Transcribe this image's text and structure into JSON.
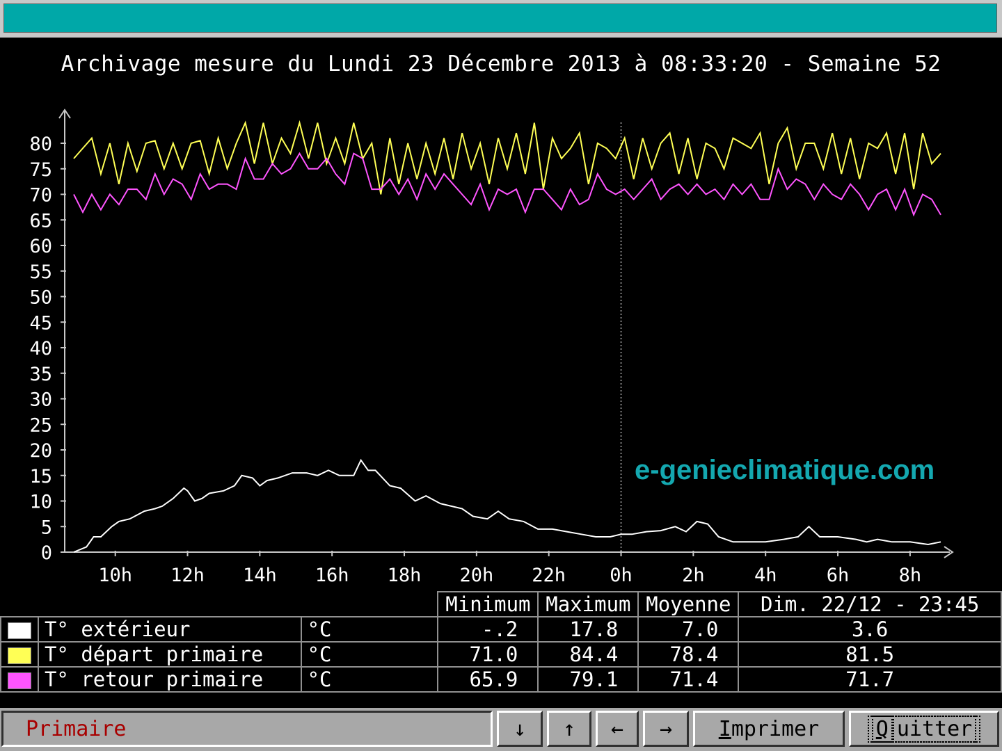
{
  "title": "Archivage mesure du Lundi 23 Décembre 2013 à 08:33:20 - Semaine 52",
  "watermark": "e-genieclimatique.com",
  "colors": {
    "exterieur": "#ffffff",
    "depart": "#ffff55",
    "retour": "#ff55ff",
    "accent": "#00a8a8"
  },
  "chart_data": {
    "type": "line",
    "title": "",
    "xlabel": "",
    "ylabel": "",
    "ylim": [
      0,
      85
    ],
    "yticks": [
      0,
      5,
      10,
      15,
      20,
      25,
      30,
      35,
      40,
      45,
      50,
      55,
      60,
      65,
      70,
      75,
      80
    ],
    "x_tick_labels": [
      {
        "x": 10,
        "label": "10h"
      },
      {
        "x": 12,
        "label": "12h"
      },
      {
        "x": 14,
        "label": "14h"
      },
      {
        "x": 16,
        "label": "16h"
      },
      {
        "x": 18,
        "label": "18h"
      },
      {
        "x": 20,
        "label": "20h"
      },
      {
        "x": 22,
        "label": "22h"
      },
      {
        "x": 24,
        "label": "0h"
      },
      {
        "x": 26,
        "label": "2h"
      },
      {
        "x": 28,
        "label": "4h"
      },
      {
        "x": 30,
        "label": "6h"
      },
      {
        "x": 32,
        "label": "8h"
      }
    ],
    "xlim": [
      8.6,
      32.85
    ],
    "marker_x": 24,
    "series": [
      {
        "name": "T° départ primaire",
        "color": "#ffff55",
        "points": [
          [
            8.85,
            77
          ],
          [
            9.35,
            81
          ],
          [
            9.6,
            74
          ],
          [
            9.85,
            80
          ],
          [
            10.1,
            72
          ],
          [
            10.35,
            80
          ],
          [
            10.6,
            74.5
          ],
          [
            10.85,
            80
          ],
          [
            11.1,
            80.5
          ],
          [
            11.35,
            75
          ],
          [
            11.6,
            80
          ],
          [
            11.85,
            75
          ],
          [
            12.1,
            80
          ],
          [
            12.35,
            80.5
          ],
          [
            12.6,
            74
          ],
          [
            12.85,
            81
          ],
          [
            13.1,
            75
          ],
          [
            13.35,
            80
          ],
          [
            13.6,
            84
          ],
          [
            13.85,
            76
          ],
          [
            14.1,
            84
          ],
          [
            14.35,
            76
          ],
          [
            14.6,
            81
          ],
          [
            14.85,
            78
          ],
          [
            15.1,
            84
          ],
          [
            15.35,
            77
          ],
          [
            15.6,
            84
          ],
          [
            15.85,
            76
          ],
          [
            16.1,
            81
          ],
          [
            16.35,
            76
          ],
          [
            16.6,
            84
          ],
          [
            16.85,
            77
          ],
          [
            17.1,
            80
          ],
          [
            17.35,
            70
          ],
          [
            17.6,
            81
          ],
          [
            17.85,
            72
          ],
          [
            18.1,
            80
          ],
          [
            18.35,
            73
          ],
          [
            18.6,
            80
          ],
          [
            18.85,
            74
          ],
          [
            19.1,
            81
          ],
          [
            19.35,
            73
          ],
          [
            19.6,
            82
          ],
          [
            19.85,
            75
          ],
          [
            20.1,
            80
          ],
          [
            20.35,
            72
          ],
          [
            20.6,
            81
          ],
          [
            20.85,
            75
          ],
          [
            21.1,
            82
          ],
          [
            21.35,
            74
          ],
          [
            21.6,
            84
          ],
          [
            21.85,
            71
          ],
          [
            22.1,
            81
          ],
          [
            22.35,
            77
          ],
          [
            22.6,
            79
          ],
          [
            22.85,
            82
          ],
          [
            23.1,
            72
          ],
          [
            23.35,
            80
          ],
          [
            23.6,
            79
          ],
          [
            23.85,
            77
          ],
          [
            24.1,
            81
          ],
          [
            24.35,
            73
          ],
          [
            24.6,
            81
          ],
          [
            24.85,
            75
          ],
          [
            25.1,
            80
          ],
          [
            25.35,
            82
          ],
          [
            25.6,
            74
          ],
          [
            25.85,
            81
          ],
          [
            26.1,
            73
          ],
          [
            26.35,
            80
          ],
          [
            26.6,
            79
          ],
          [
            26.85,
            75
          ],
          [
            27.1,
            81
          ],
          [
            27.35,
            80
          ],
          [
            27.6,
            79
          ],
          [
            27.85,
            82
          ],
          [
            28.1,
            72
          ],
          [
            28.35,
            80
          ],
          [
            28.6,
            83
          ],
          [
            28.85,
            75
          ],
          [
            29.1,
            80
          ],
          [
            29.35,
            80
          ],
          [
            29.6,
            75
          ],
          [
            29.85,
            82
          ],
          [
            30.1,
            74
          ],
          [
            30.35,
            81
          ],
          [
            30.6,
            73
          ],
          [
            30.85,
            80
          ],
          [
            31.1,
            79
          ],
          [
            31.35,
            82
          ],
          [
            31.6,
            74
          ],
          [
            31.85,
            82
          ],
          [
            32.1,
            71
          ],
          [
            32.35,
            82
          ],
          [
            32.6,
            76
          ],
          [
            32.85,
            78
          ]
        ]
      },
      {
        "name": "T° retour primaire",
        "color": "#ff55ff",
        "points": [
          [
            8.85,
            70
          ],
          [
            9.1,
            66.5
          ],
          [
            9.35,
            70
          ],
          [
            9.6,
            67
          ],
          [
            9.85,
            70
          ],
          [
            10.1,
            68
          ],
          [
            10.35,
            71
          ],
          [
            10.6,
            71
          ],
          [
            10.85,
            69
          ],
          [
            11.1,
            74
          ],
          [
            11.35,
            70
          ],
          [
            11.6,
            73
          ],
          [
            11.85,
            72
          ],
          [
            12.1,
            69
          ],
          [
            12.35,
            74
          ],
          [
            12.6,
            71
          ],
          [
            12.85,
            72
          ],
          [
            13.1,
            72
          ],
          [
            13.35,
            71
          ],
          [
            13.6,
            77
          ],
          [
            13.85,
            73
          ],
          [
            14.1,
            73
          ],
          [
            14.35,
            76
          ],
          [
            14.6,
            74
          ],
          [
            14.85,
            75
          ],
          [
            15.1,
            78
          ],
          [
            15.35,
            75
          ],
          [
            15.6,
            75
          ],
          [
            15.85,
            77
          ],
          [
            16.1,
            74
          ],
          [
            16.35,
            72
          ],
          [
            16.6,
            78
          ],
          [
            16.85,
            77
          ],
          [
            17.1,
            71
          ],
          [
            17.35,
            71
          ],
          [
            17.6,
            73
          ],
          [
            17.85,
            70
          ],
          [
            18.1,
            73
          ],
          [
            18.35,
            69
          ],
          [
            18.6,
            74
          ],
          [
            18.85,
            71
          ],
          [
            19.1,
            74
          ],
          [
            19.35,
            72
          ],
          [
            19.6,
            70
          ],
          [
            19.85,
            68
          ],
          [
            20.1,
            72
          ],
          [
            20.35,
            67
          ],
          [
            20.6,
            71
          ],
          [
            20.85,
            70
          ],
          [
            21.1,
            71
          ],
          [
            21.35,
            66.5
          ],
          [
            21.6,
            71
          ],
          [
            21.85,
            71
          ],
          [
            22.1,
            69
          ],
          [
            22.35,
            67
          ],
          [
            22.6,
            71
          ],
          [
            22.85,
            68
          ],
          [
            23.1,
            69
          ],
          [
            23.35,
            74
          ],
          [
            23.6,
            71
          ],
          [
            23.85,
            70
          ],
          [
            24.1,
            71
          ],
          [
            24.35,
            69
          ],
          [
            24.6,
            71
          ],
          [
            24.85,
            73
          ],
          [
            25.1,
            69
          ],
          [
            25.35,
            71
          ],
          [
            25.6,
            72
          ],
          [
            25.85,
            70
          ],
          [
            26.1,
            72
          ],
          [
            26.35,
            70
          ],
          [
            26.6,
            71
          ],
          [
            26.85,
            69
          ],
          [
            27.1,
            72
          ],
          [
            27.35,
            70
          ],
          [
            27.6,
            72
          ],
          [
            27.85,
            69
          ],
          [
            28.1,
            69
          ],
          [
            28.35,
            75
          ],
          [
            28.6,
            71
          ],
          [
            28.85,
            73
          ],
          [
            29.1,
            72
          ],
          [
            29.35,
            69
          ],
          [
            29.6,
            72
          ],
          [
            29.85,
            70
          ],
          [
            30.1,
            69
          ],
          [
            30.35,
            72
          ],
          [
            30.6,
            70
          ],
          [
            30.85,
            67
          ],
          [
            31.1,
            70
          ],
          [
            31.35,
            71
          ],
          [
            31.6,
            67
          ],
          [
            31.85,
            71
          ],
          [
            32.1,
            66
          ],
          [
            32.35,
            70
          ],
          [
            32.6,
            69
          ],
          [
            32.85,
            66
          ]
        ]
      },
      {
        "name": "T° extérieur",
        "color": "#ffffff",
        "points": [
          [
            8.85,
            0
          ],
          [
            9.2,
            1
          ],
          [
            9.4,
            3
          ],
          [
            9.6,
            3
          ],
          [
            9.9,
            5
          ],
          [
            10.1,
            6
          ],
          [
            10.4,
            6.5
          ],
          [
            10.8,
            8
          ],
          [
            11.1,
            8.5
          ],
          [
            11.3,
            9
          ],
          [
            11.6,
            10.5
          ],
          [
            11.9,
            12.5
          ],
          [
            12,
            12
          ],
          [
            12.2,
            10
          ],
          [
            12.4,
            10.5
          ],
          [
            12.6,
            11.5
          ],
          [
            13,
            12
          ],
          [
            13.3,
            13
          ],
          [
            13.5,
            15
          ],
          [
            13.8,
            14.5
          ],
          [
            14,
            13
          ],
          [
            14.2,
            14
          ],
          [
            14.5,
            14.5
          ],
          [
            14.9,
            15.5
          ],
          [
            15.3,
            15.5
          ],
          [
            15.6,
            15
          ],
          [
            15.9,
            16
          ],
          [
            16.2,
            15
          ],
          [
            16.6,
            15
          ],
          [
            16.8,
            18
          ],
          [
            17,
            16
          ],
          [
            17.2,
            16
          ],
          [
            17.6,
            13
          ],
          [
            17.9,
            12.5
          ],
          [
            18.3,
            10
          ],
          [
            18.6,
            11
          ],
          [
            19,
            9.5
          ],
          [
            19.3,
            9
          ],
          [
            19.6,
            8.5
          ],
          [
            19.9,
            7
          ],
          [
            20.3,
            6.5
          ],
          [
            20.6,
            8
          ],
          [
            20.9,
            6.5
          ],
          [
            21.3,
            6
          ],
          [
            21.7,
            4.5
          ],
          [
            22.1,
            4.5
          ],
          [
            22.5,
            4
          ],
          [
            22.9,
            3.5
          ],
          [
            23.3,
            3
          ],
          [
            23.7,
            3
          ],
          [
            24,
            3.5
          ],
          [
            24.3,
            3.5
          ],
          [
            24.7,
            4
          ],
          [
            25.1,
            4.2
          ],
          [
            25.5,
            5
          ],
          [
            25.8,
            4
          ],
          [
            26.1,
            6
          ],
          [
            26.4,
            5.5
          ],
          [
            26.7,
            3
          ],
          [
            27.1,
            2
          ],
          [
            27.6,
            2
          ],
          [
            28,
            2
          ],
          [
            28.5,
            2.5
          ],
          [
            28.9,
            3
          ],
          [
            29.2,
            5
          ],
          [
            29.5,
            3
          ],
          [
            30,
            3
          ],
          [
            30.5,
            2.5
          ],
          [
            30.8,
            2
          ],
          [
            31.1,
            2.5
          ],
          [
            31.5,
            2
          ],
          [
            32,
            2
          ],
          [
            32.5,
            1.5
          ],
          [
            32.85,
            2
          ]
        ]
      }
    ]
  },
  "table": {
    "headers": [
      "Minimum",
      "Maximum",
      "Moyenne",
      "Dim. 22/12 - 23:45"
    ],
    "rows": [
      {
        "label": "T° extérieur",
        "unit": "°C",
        "min": "-.2",
        "max": "17.8",
        "avg": "7.0",
        "cur": "3.6",
        "color": "#ffffff"
      },
      {
        "label": "T° départ primaire",
        "unit": "°C",
        "min": "71.0",
        "max": "84.4",
        "avg": "78.4",
        "cur": "81.5",
        "color": "#ffff55"
      },
      {
        "label": "T° retour primaire",
        "unit": "°C",
        "min": "65.9",
        "max": "79.1",
        "avg": "71.4",
        "cur": "71.7",
        "color": "#ff55ff"
      }
    ]
  },
  "statusbar": {
    "label": "Primaire",
    "btn_down": "↓",
    "btn_up": "↑",
    "btn_left": "←",
    "btn_right": "→",
    "print_first": "I",
    "print_rest": "mprimer",
    "quit_first": "Q",
    "quit_rest": "uitter"
  }
}
